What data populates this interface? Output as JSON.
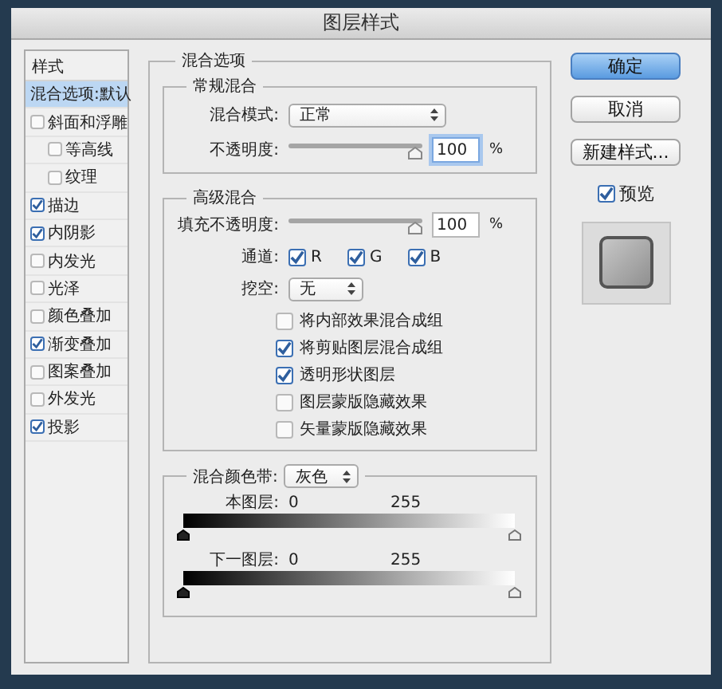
{
  "window": {
    "title": "图层样式"
  },
  "sidebar": {
    "header": "样式",
    "items": [
      {
        "label": "混合选项:默认",
        "kind": "option",
        "selected": true
      },
      {
        "label": "斜面和浮雕",
        "kind": "check",
        "checked": false,
        "selected": false,
        "children": [
          {
            "label": "等高线",
            "checked": false,
            "selected": false
          },
          {
            "label": "纹理",
            "checked": false,
            "selected": false
          }
        ]
      },
      {
        "label": "描边",
        "kind": "check",
        "checked": true,
        "selected": false
      },
      {
        "label": "内阴影",
        "kind": "check",
        "checked": true,
        "selected": false
      },
      {
        "label": "内发光",
        "kind": "check",
        "checked": false,
        "selected": false
      },
      {
        "label": "光泽",
        "kind": "check",
        "checked": false,
        "selected": false
      },
      {
        "label": "颜色叠加",
        "kind": "check",
        "checked": false,
        "selected": false
      },
      {
        "label": "渐变叠加",
        "kind": "check",
        "checked": true,
        "selected": false
      },
      {
        "label": "图案叠加",
        "kind": "check",
        "checked": false,
        "selected": false
      },
      {
        "label": "外发光",
        "kind": "check",
        "checked": false,
        "selected": false
      },
      {
        "label": "投影",
        "kind": "check",
        "checked": true,
        "selected": false
      }
    ]
  },
  "main": {
    "title": "混合选项",
    "general": {
      "title": "常规混合",
      "blend_mode": {
        "label": "混合模式:",
        "value": "正常"
      },
      "opacity": {
        "label": "不透明度:",
        "level": 1,
        "value": "100",
        "unit": "%",
        "focused": true
      }
    },
    "advanced": {
      "title": "高级混合",
      "fill_opacity": {
        "label": "填充不透明度:",
        "level": 1,
        "value": "100",
        "unit": "%",
        "focused": false
      },
      "channels": {
        "label": "通道:",
        "items": [
          {
            "label": "R",
            "checked": true
          },
          {
            "label": "G",
            "checked": true
          },
          {
            "label": "B",
            "checked": true
          }
        ]
      },
      "knockout": {
        "label": "挖空:",
        "value": "无"
      },
      "options": [
        {
          "label": "将内部效果混合成组",
          "checked": false
        },
        {
          "label": "将剪贴图层混合成组",
          "checked": true
        },
        {
          "label": "透明形状图层",
          "checked": true
        },
        {
          "label": "图层蒙版隐藏效果",
          "checked": false
        },
        {
          "label": "矢量蒙版隐藏效果",
          "checked": false
        }
      ]
    },
    "blend_if": {
      "label": "混合颜色带:",
      "value": "灰色",
      "sliders": [
        {
          "label": "本图层:",
          "low": "0",
          "high": "255",
          "thumbs": [
            {
              "kind": "black",
              "level": 0
            },
            {
              "kind": "white",
              "level": 1
            }
          ]
        },
        {
          "label": "下一图层:",
          "low": "0",
          "high": "255",
          "thumbs": [
            {
              "kind": "black",
              "level": 0
            },
            {
              "kind": "white",
              "level": 1
            }
          ]
        }
      ]
    }
  },
  "actions": {
    "buttons": [
      {
        "label": "确定",
        "kind": "primary"
      },
      {
        "label": "取消",
        "kind": "normal"
      },
      {
        "label": "新建样式...",
        "kind": "normal"
      }
    ],
    "preview": {
      "label": "预览",
      "checked": true
    }
  }
}
